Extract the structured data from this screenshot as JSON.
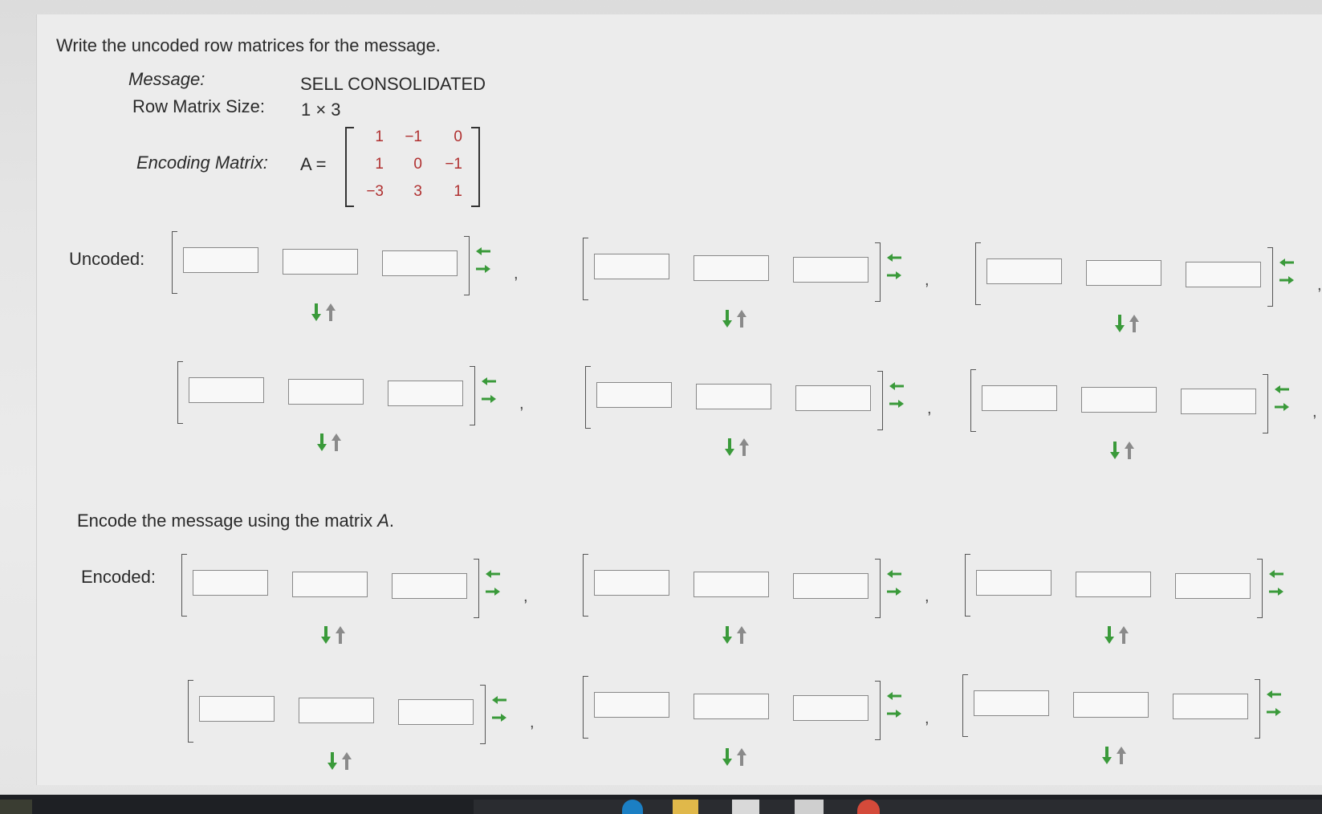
{
  "problem": {
    "prompt": "Write the uncoded row matrices for the message.",
    "message_label": "Message:",
    "message_value": "SELL CONSOLIDATED",
    "size_label": "Row Matrix Size:",
    "size_value": "1 × 3",
    "encoding_label": "Encoding Matrix:",
    "matrix_name": "A =",
    "matrix": [
      [
        "1",
        "−1",
        "0"
      ],
      [
        "1",
        "0",
        "−1"
      ],
      [
        "−3",
        "3",
        "1"
      ]
    ]
  },
  "uncoded": {
    "label": "Uncoded:",
    "matrix_count": 6,
    "cells_per_matrix": 3
  },
  "encode": {
    "prompt_prefix": "Encode the message using the matrix ",
    "prompt_var": "A",
    "prompt_suffix": ".",
    "label": "Encoded:",
    "matrix_count": 6,
    "cells_per_matrix": 3
  },
  "colors": {
    "arrow_green": "#3a9a3a",
    "arrow_gray": "#8a8a8a",
    "matrix_entry": "#b03030"
  },
  "icons": [
    "left-arrow-icon",
    "right-arrow-icon",
    "down-arrow-icon",
    "up-arrow-icon"
  ]
}
